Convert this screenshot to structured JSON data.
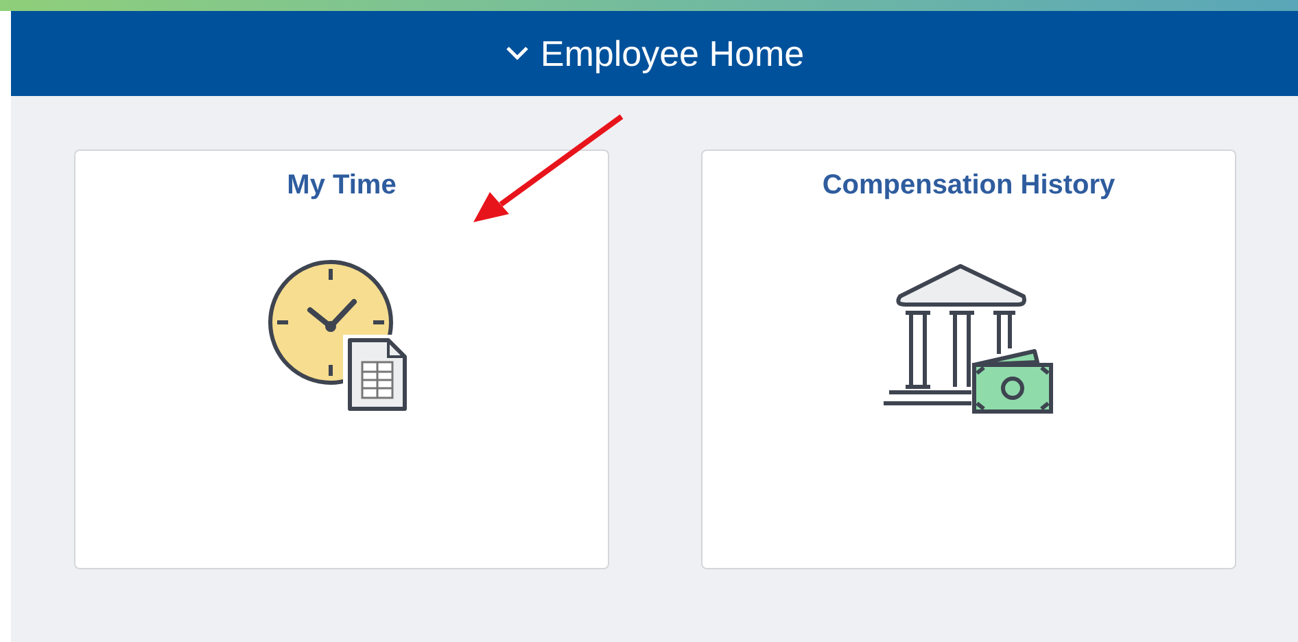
{
  "header": {
    "title": "Employee Home"
  },
  "tiles": [
    {
      "title": "My Time",
      "kind": "time"
    },
    {
      "title": "Compensation History",
      "kind": "bank"
    }
  ]
}
